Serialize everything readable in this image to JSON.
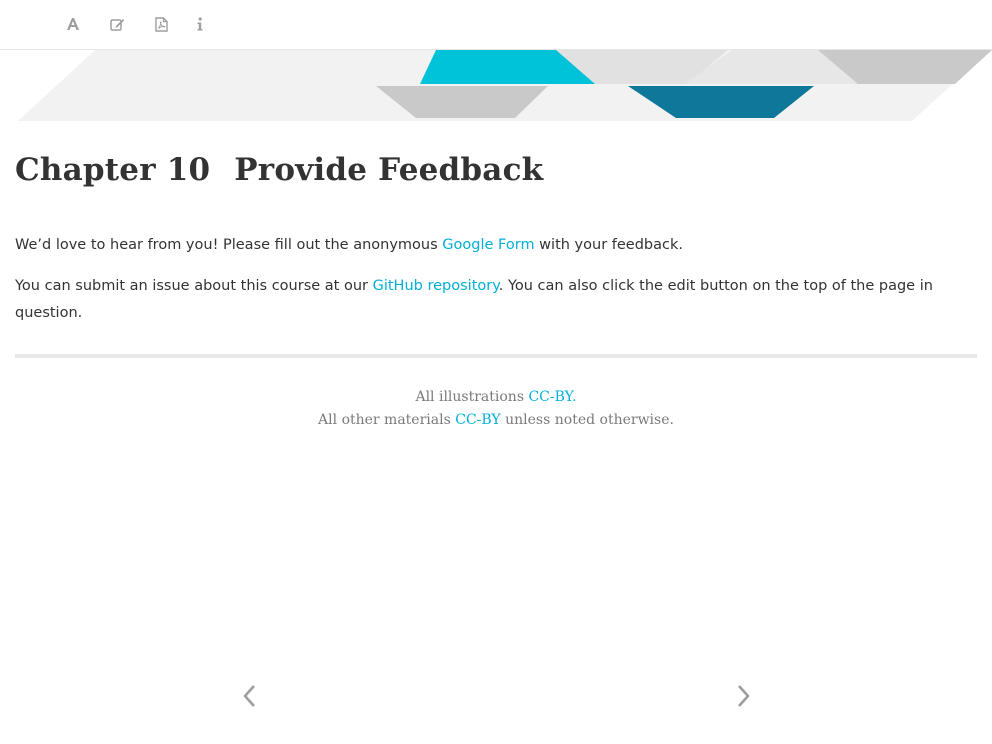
{
  "toolbar": {
    "buttons": [
      {
        "icon": "font-settings-icon"
      },
      {
        "icon": "edit-icon"
      },
      {
        "icon": "pdf-icon"
      },
      {
        "icon": "info-icon"
      }
    ]
  },
  "colors": {
    "link": "#00b0d8",
    "banner_cyan": "#00c3d9",
    "banner_blue": "#0e779a",
    "banner_grey": "#c9c9c9",
    "banner_light": "#efefef",
    "text": "#333333",
    "icon": "#9e9e9e"
  },
  "chapter": {
    "number": "Chapter 10",
    "title": "Provide Feedback"
  },
  "content": {
    "p1_before": "We’d love to hear from you! Please fill out the anonymous ",
    "p1_link": "Google Form",
    "p1_after": " with your feedback.",
    "p2_before": "You can submit an issue about this course at our ",
    "p2_link": "GitHub repository",
    "p2_after": ". You can also click the edit button on the top of the page in question."
  },
  "footer": {
    "line1_before": "All illustrations ",
    "line1_link": "CC-BY.",
    "line2_before": "All other materials ",
    "line2_link": "CC-BY",
    "line2_after": " unless noted otherwise."
  },
  "navigation": {
    "prev_icon": "chevron-left-icon",
    "next_icon": "chevron-right-icon"
  }
}
